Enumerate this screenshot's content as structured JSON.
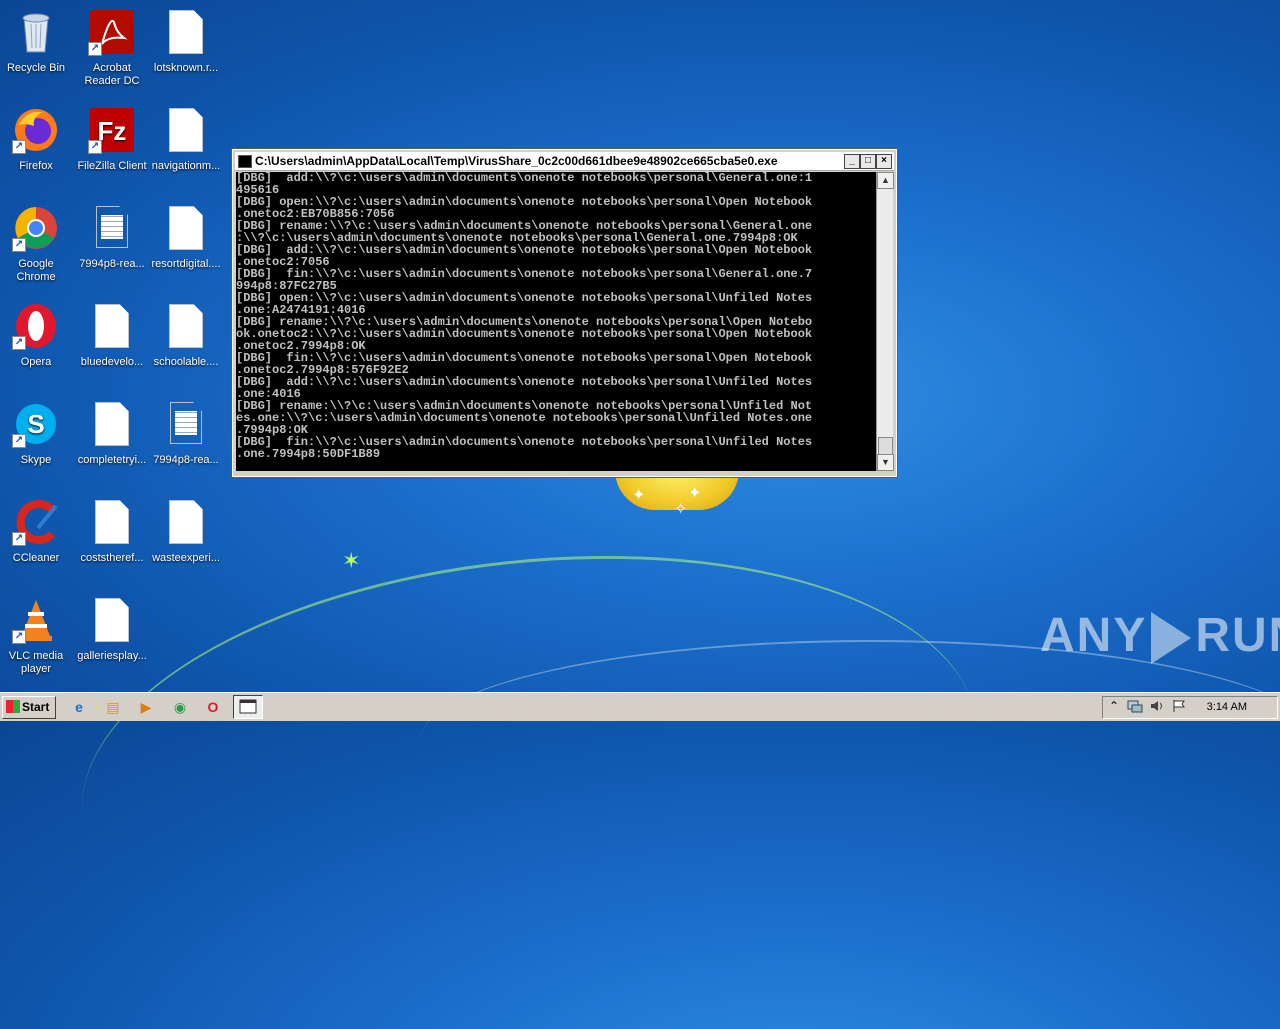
{
  "desktop": {
    "icons": [
      {
        "label": "Recycle Bin",
        "icon": "recycle-bin-icon"
      },
      {
        "label": "Acrobat Reader DC",
        "icon": "acrobat-icon"
      },
      {
        "label": "lotsknown.r...",
        "icon": "file-icon"
      },
      {
        "label": "Firefox",
        "icon": "firefox-icon"
      },
      {
        "label": "FileZilla Client",
        "icon": "filezilla-icon"
      },
      {
        "label": "navigationm...",
        "icon": "file-icon"
      },
      {
        "label": "Google Chrome",
        "icon": "chrome-icon"
      },
      {
        "label": "7994p8-rea...",
        "icon": "text-file-icon"
      },
      {
        "label": "resortdigital....",
        "icon": "file-icon"
      },
      {
        "label": "Opera",
        "icon": "opera-icon"
      },
      {
        "label": "bluedevelo...",
        "icon": "file-icon"
      },
      {
        "label": "schoolable....",
        "icon": "file-icon"
      },
      {
        "label": "Skype",
        "icon": "skype-icon"
      },
      {
        "label": "completetryi...",
        "icon": "file-icon"
      },
      {
        "label": "7994p8-rea...",
        "icon": "text-file-icon"
      },
      {
        "label": "CCleaner",
        "icon": "ccleaner-icon"
      },
      {
        "label": "coststheref...",
        "icon": "file-icon"
      },
      {
        "label": "wasteexperi...",
        "icon": "file-icon"
      },
      {
        "label": "VLC media player",
        "icon": "vlc-icon"
      },
      {
        "label": "galleriesplay...",
        "icon": "file-icon"
      }
    ]
  },
  "console_window": {
    "title": "C:\\Users\\admin\\AppData\\Local\\Temp\\VirusShare_0c2c00d661dbee9e48902ce665cba5e0.exe",
    "minimize": "_",
    "maximize": "□",
    "close": "×",
    "lines": [
      "[DBG]  add:\\\\?\\c:\\users\\admin\\documents\\onenote notebooks\\personal\\General.one:1",
      "495616",
      "[DBG] open:\\\\?\\c:\\users\\admin\\documents\\onenote notebooks\\personal\\Open Notebook",
      ".onetoc2:EB70B856:7056",
      "[DBG] rename:\\\\?\\c:\\users\\admin\\documents\\onenote notebooks\\personal\\General.one",
      ":\\\\?\\c:\\users\\admin\\documents\\onenote notebooks\\personal\\General.one.7994p8:OK",
      "[DBG]  add:\\\\?\\c:\\users\\admin\\documents\\onenote notebooks\\personal\\Open Notebook",
      ".onetoc2:7056",
      "[DBG]  fin:\\\\?\\c:\\users\\admin\\documents\\onenote notebooks\\personal\\General.one.7",
      "994p8:87FC27B5",
      "[DBG] open:\\\\?\\c:\\users\\admin\\documents\\onenote notebooks\\personal\\Unfiled Notes",
      ".one:A2474191:4016",
      "[DBG] rename:\\\\?\\c:\\users\\admin\\documents\\onenote notebooks\\personal\\Open Notebo",
      "ok.onetoc2:\\\\?\\c:\\users\\admin\\documents\\onenote notebooks\\personal\\Open Notebook",
      ".onetoc2.7994p8:OK",
      "[DBG]  fin:\\\\?\\c:\\users\\admin\\documents\\onenote notebooks\\personal\\Open Notebook",
      ".onetoc2.7994p8:576F92E2",
      "[DBG]  add:\\\\?\\c:\\users\\admin\\documents\\onenote notebooks\\personal\\Unfiled Notes",
      ".one:4016",
      "[DBG] rename:\\\\?\\c:\\users\\admin\\documents\\onenote notebooks\\personal\\Unfiled Not",
      "es.one:\\\\?\\c:\\users\\admin\\documents\\onenote notebooks\\personal\\Unfiled Notes.one",
      ".7994p8:OK",
      "[DBG]  fin:\\\\?\\c:\\users\\admin\\documents\\onenote notebooks\\personal\\Unfiled Notes",
      ".one.7994p8:50DF1B89"
    ],
    "scroll_up": "▲",
    "scroll_down": "▼"
  },
  "watermark": {
    "left": "ANY",
    "right": "RUN"
  },
  "taskbar": {
    "start_label": "Start",
    "apps": [
      {
        "icon": "internet-explorer-icon",
        "glyph": "e"
      },
      {
        "icon": "folder-icon",
        "glyph": "▤"
      },
      {
        "icon": "media-player-icon",
        "glyph": "▶"
      },
      {
        "icon": "chrome-icon",
        "glyph": "◉"
      },
      {
        "icon": "opera-icon",
        "glyph": "O"
      }
    ],
    "tray": {
      "show_hidden": "⌃",
      "clock": "3:14 AM"
    }
  },
  "colors": {
    "desktop_blue": "#1c6fcd",
    "console_bg": "#000000",
    "console_text": "#c0c0c0",
    "taskbar": "#d4d0c8"
  }
}
